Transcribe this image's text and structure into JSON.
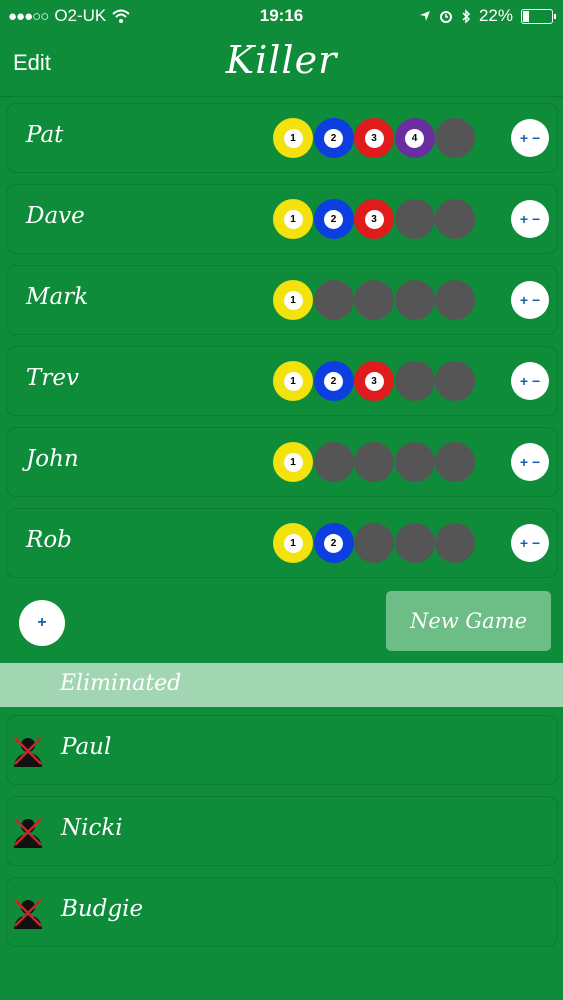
{
  "status": {
    "carrier": "O2-UK",
    "signal": "●●●○○",
    "time": "19:16",
    "battery": "22%"
  },
  "nav": {
    "edit": "Edit",
    "title": "Killer"
  },
  "colors": {
    "ball1": "#f4e20c",
    "ball2": "#0c3ee0",
    "ball3": "#e01b1b",
    "ball4": "#6b2ea0",
    "empty": "#555555"
  },
  "players": [
    {
      "name": "Pat",
      "lives": [
        1,
        2,
        3,
        4
      ]
    },
    {
      "name": "Dave",
      "lives": [
        1,
        2,
        3
      ]
    },
    {
      "name": "Mark",
      "lives": [
        1
      ]
    },
    {
      "name": "Trev",
      "lives": [
        1,
        2,
        3
      ]
    },
    {
      "name": "John",
      "lives": [
        1
      ]
    },
    {
      "name": "Rob",
      "lives": [
        1,
        2
      ]
    }
  ],
  "plus_minus_label": "+ −",
  "add_label": "+",
  "new_game": "New Game",
  "eliminated_header": "Eliminated",
  "eliminated": [
    "Paul",
    "Nicki",
    "Budgie"
  ]
}
